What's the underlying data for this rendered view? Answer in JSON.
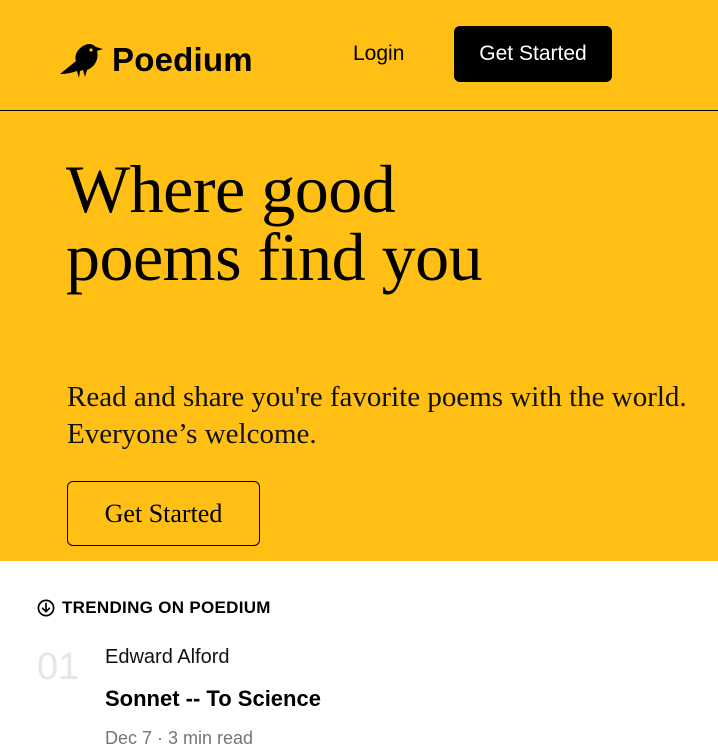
{
  "header": {
    "brand": "Poedium",
    "login_label": "Login",
    "cta_label": "Get Started",
    "brand_icon": "bird-icon",
    "background_color": "#FFBF14"
  },
  "hero": {
    "title_line1": "Where good",
    "title_line2": "poems find you",
    "subtitle": "Read and share you're favorite poems with the world. Everyone’s welcome.",
    "cta_label": "Get Started"
  },
  "trending": {
    "icon": "trending-down-circle-icon",
    "label": "TRENDING ON POEDIUM",
    "items": [
      {
        "rank": "01",
        "author": "Edward Alford",
        "title": "Sonnet -- To Science",
        "meta": "Dec 7 · 3 min read"
      }
    ]
  }
}
